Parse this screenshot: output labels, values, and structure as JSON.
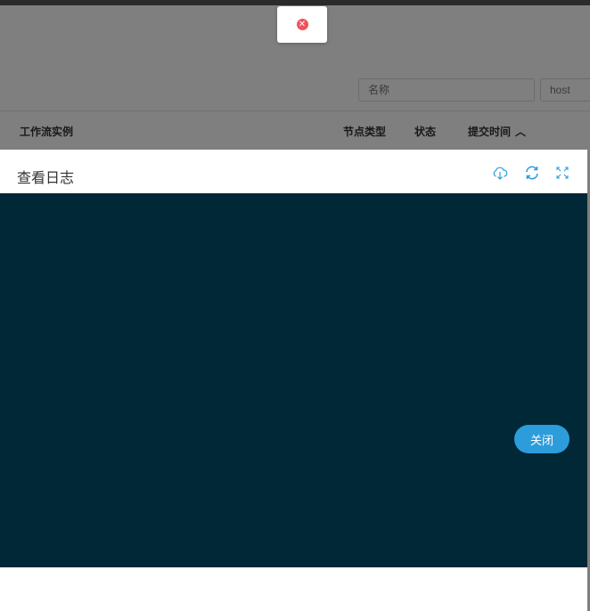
{
  "search": {
    "name_placeholder": "名称",
    "host_placeholder": "host"
  },
  "table": {
    "headers": {
      "instance": "工作流实例",
      "node_type": "节点类型",
      "state": "状态",
      "submit_time": "提交时间"
    }
  },
  "toast": {
    "icon": "error-icon"
  },
  "dialog": {
    "title": "查看日志",
    "icons": {
      "download": "cloud-download-icon",
      "refresh": "refresh-icon",
      "fullscreen": "fullscreen-icon"
    },
    "log_background": "#012836",
    "close_label": "关闭"
  },
  "colors": {
    "accent": "#2d9cdb",
    "error": "#f0535b"
  }
}
